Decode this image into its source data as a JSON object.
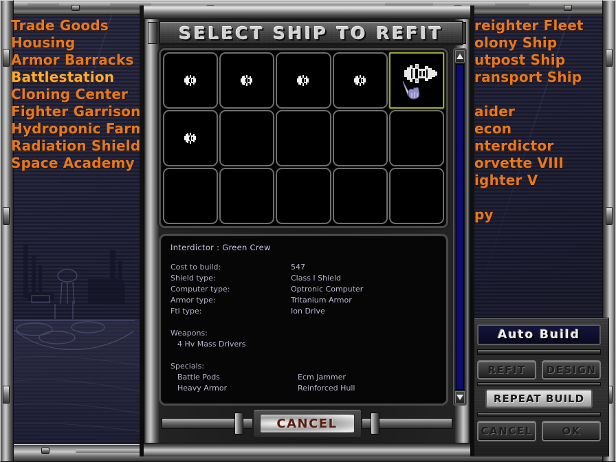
{
  "window": {
    "title": "SELECT SHIP TO REFIT"
  },
  "left_menu": {
    "items": [
      {
        "label": "Trade Goods",
        "selected": false
      },
      {
        "label": "Housing",
        "selected": false
      },
      {
        "label": "Armor Barracks",
        "selected": false
      },
      {
        "label": "Battlestation",
        "selected": true
      },
      {
        "label": "Cloning Center",
        "selected": false
      },
      {
        "label": "Fighter Garrison",
        "selected": false
      },
      {
        "label": "Hydroponic Farm",
        "selected": false
      },
      {
        "label": "Radiation Shield",
        "selected": false
      },
      {
        "label": "Space Academy",
        "selected": false
      }
    ]
  },
  "right_menu": {
    "group_one": [
      {
        "label": "reighter Fleet"
      },
      {
        "label": "olony Ship"
      },
      {
        "label": "utpost Ship"
      },
      {
        "label": "ransport Ship"
      }
    ],
    "group_two": [
      {
        "label": "aider"
      },
      {
        "label": "econ"
      },
      {
        "label": "nterdictor"
      },
      {
        "label": "orvette VIII"
      },
      {
        "label": "ighter V"
      }
    ],
    "group_three": [
      {
        "label": "py"
      }
    ]
  },
  "ship_grid": {
    "rows": 3,
    "columns": 5,
    "cells": [
      {
        "occupied": true,
        "selected": false
      },
      {
        "occupied": true,
        "selected": false
      },
      {
        "occupied": true,
        "selected": false
      },
      {
        "occupied": true,
        "selected": false
      },
      {
        "occupied": true,
        "selected": true
      },
      {
        "occupied": true,
        "selected": false
      },
      {
        "occupied": false,
        "selected": false
      },
      {
        "occupied": false,
        "selected": false
      },
      {
        "occupied": false,
        "selected": false
      },
      {
        "occupied": false,
        "selected": false
      },
      {
        "occupied": false,
        "selected": false
      },
      {
        "occupied": false,
        "selected": false
      },
      {
        "occupied": false,
        "selected": false
      },
      {
        "occupied": false,
        "selected": false
      },
      {
        "occupied": false,
        "selected": false
      }
    ]
  },
  "info_panel": {
    "ship_title": "Interdictor : Green Crew",
    "stats": [
      {
        "label": "Cost to build:",
        "value": "547"
      },
      {
        "label": "Shield type:",
        "value": "Class I Shield"
      },
      {
        "label": "Computer type:",
        "value": "Optronic Computer"
      },
      {
        "label": "Armor type:",
        "value": "Tritanium Armor"
      },
      {
        "label": "Ftl type:",
        "value": "Ion Drive"
      }
    ],
    "weapons_header": "Weapons:",
    "weapons": [
      "4 Hv Mass Drivers"
    ],
    "specials_header": "Specials:",
    "specials": [
      {
        "left": "Battle Pods",
        "right": "Ecm Jammer"
      },
      {
        "left": "Heavy Armor",
        "right": "Reinforced Hull"
      }
    ]
  },
  "dialog_buttons": {
    "cancel": "CANCEL"
  },
  "right_panel": {
    "auto_build": "Auto  Build",
    "refit": "REFIT",
    "design": "DESIGN",
    "repeat_build": "REPEAT BUILD",
    "cancel": "CANCEL",
    "ok": "OK"
  },
  "scrollbar": {
    "up_arrow": "scroll-up-arrow",
    "down_arrow": "scroll-down-arrow"
  },
  "colors": {
    "menu_orange": "#e5791b",
    "menu_orange_selected": "#ffad2b",
    "info_text": "#b6b6cd",
    "selection_border": "#9aa33a",
    "scrollbar_track": "#0d0d6e",
    "auto_build_bg": "#15153a",
    "cancel_text": "#5a1c10"
  }
}
